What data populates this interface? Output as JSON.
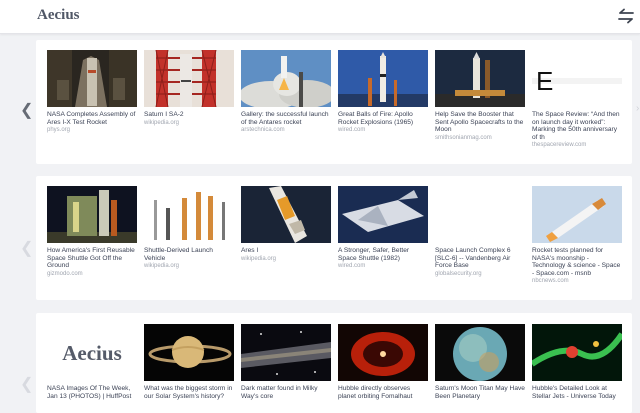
{
  "header": {
    "title": "Aecius",
    "swap_icon": "swap-arrows-icon"
  },
  "nav": {
    "prev_glyph": "❮",
    "next_glyph": "›"
  },
  "rows": [
    {
      "cards": [
        {
          "title": "NASA Completes Assembly of Ares I-X Test Rocket",
          "source": "phys.org",
          "image": "rocket-in-assembly-building"
        },
        {
          "title": "Saturn I SA-2",
          "source": "wikipedia.org",
          "image": "rocket-launch-tower"
        },
        {
          "title": "Gallery: the successful launch of the Antares rocket",
          "source": "arstechnica.com",
          "image": "rocket-launch-smoke"
        },
        {
          "title": "Great Balls of Fire: Apollo Rocket Explosions (1965)",
          "source": "wired.com",
          "image": "saturn-v-on-pad"
        },
        {
          "title": "Help Save the Booster that Sent Apollo Spacecrafts to the Moon",
          "source": "smithsonianmag.com",
          "image": "saturn-v-night"
        },
        {
          "title": "The Space Review: “And then on launch day it worked”: Marking the 50th anniversary of th",
          "source": "thespacereview.com",
          "image": "site-logo-e"
        }
      ]
    },
    {
      "cards": [
        {
          "title": "How America's First Reusable Space Shuttle Got Off the Ground",
          "source": "gizmodo.com",
          "image": "shuttle-on-pad"
        },
        {
          "title": "Shuttle-Derived Launch Vehicle",
          "source": "wikipedia.org",
          "image": "rocket-comparison"
        },
        {
          "title": "Ares I",
          "source": "wikipedia.org",
          "image": "ares-rocket-in-space"
        },
        {
          "title": "A Stronger, Safer, Better Space Shuttle (1982)",
          "source": "wired.com",
          "image": "shuttle-concept"
        },
        {
          "title": "Space Launch Complex 6 [SLC-6] -- Vandenberg Air Force Base",
          "source": "globalsecurity.org",
          "image": ""
        },
        {
          "title": "Rocket tests planned for NASA's moonship - Technology & science - Space - Space.com - msnb",
          "source": "nbcnews.com",
          "image": "rocket-in-sky"
        }
      ]
    },
    {
      "cards": [
        {
          "title": "NASA Images Of The Week, Jan 13 (PHOTOS) | HuffPost",
          "source": "",
          "image": "aecius-logo"
        },
        {
          "title": "What was the biggest storm in our Solar System's history?",
          "source": "",
          "image": "saturn"
        },
        {
          "title": "Dark matter found in Milky Way's core",
          "source": "",
          "image": "milky-way"
        },
        {
          "title": "Hubble directly observes planet orbiting Fomalhaut",
          "source": "",
          "image": "fomalhaut"
        },
        {
          "title": "Saturn's Moon Titan May Have Been Planetary",
          "source": "",
          "image": "titan"
        },
        {
          "title": "Hubble's Detailed Look at Stellar Jets - Universe Today",
          "source": "",
          "image": "stellar-jets"
        }
      ]
    }
  ],
  "logo_text": "Aecius",
  "logo_e": "E"
}
